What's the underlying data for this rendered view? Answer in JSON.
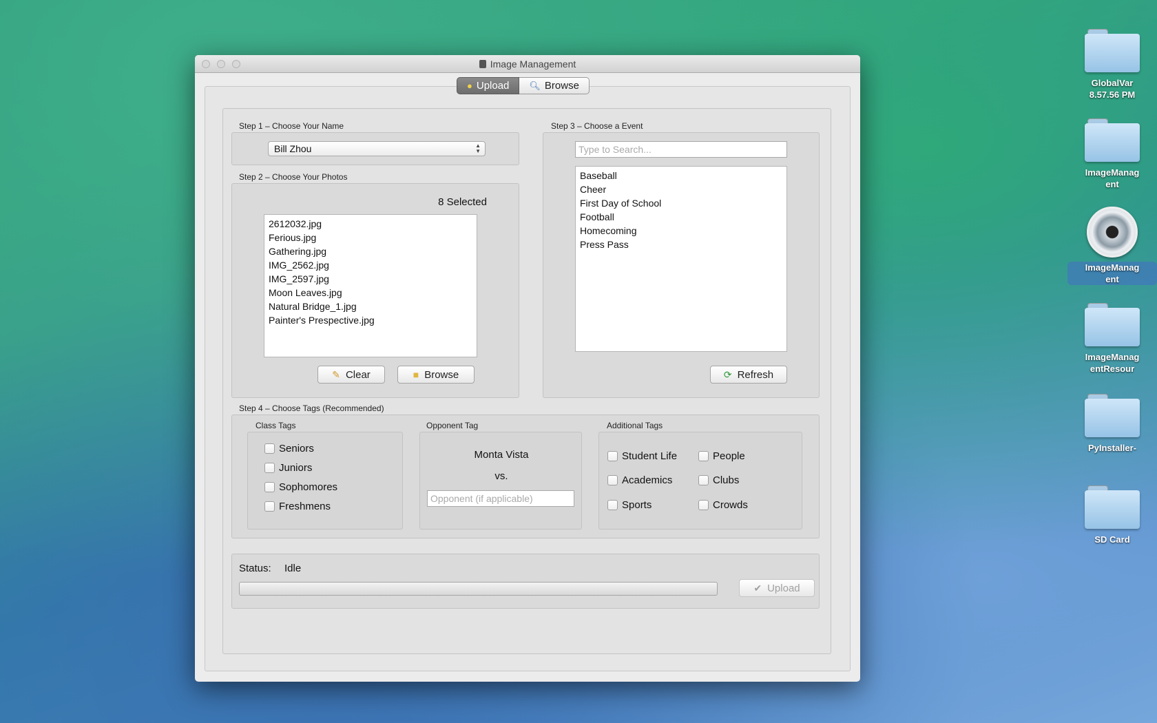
{
  "desktop": {
    "icons": [
      {
        "label": "GlobalVar\n8.57.56 PM",
        "kind": "folder"
      },
      {
        "label": "ImageManag\nent",
        "kind": "folder"
      },
      {
        "label": "ImageManag\nent",
        "kind": "app"
      },
      {
        "label": "ImageManag\nentResour",
        "kind": "folder"
      },
      {
        "label": "PyInstaller-",
        "kind": "folder"
      },
      {
        "label": "SD Card",
        "kind": "folder"
      }
    ]
  },
  "window": {
    "title": "Image Management",
    "tabs": [
      {
        "label": "Upload",
        "active": true
      },
      {
        "label": "Browse",
        "active": false
      }
    ]
  },
  "step1": {
    "label": "Step 1 – Choose Your Name",
    "selected_name": "Bill Zhou"
  },
  "step2": {
    "label": "Step 2 – Choose Your Photos",
    "selected_count": "8 Selected",
    "photos": [
      "2612032.jpg",
      "Ferious.jpg",
      "Gathering.jpg",
      "IMG_2562.jpg",
      "IMG_2597.jpg",
      "Moon Leaves.jpg",
      "Natural Bridge_1.jpg",
      "Painter's Prespective.jpg"
    ],
    "clear_label": "Clear",
    "browse_label": "Browse"
  },
  "step3": {
    "label": "Step 3 – Choose a Event",
    "search_placeholder": "Type to Search...",
    "events": [
      "Baseball",
      "Cheer",
      "First Day of School",
      "Football",
      "Homecoming",
      "Press Pass"
    ],
    "refresh_label": "Refresh"
  },
  "step4": {
    "label": "Step 4 – Choose Tags (Recommended)",
    "class_tags": {
      "label": "Class Tags",
      "items": [
        "Seniors",
        "Juniors",
        "Sophomores",
        "Freshmens"
      ]
    },
    "opponent_tag": {
      "label": "Opponent Tag",
      "home": "Monta Vista",
      "vs": "vs.",
      "placeholder": "Opponent (if applicable)"
    },
    "additional_tags": {
      "label": "Additional Tags",
      "items": [
        "Student Life",
        "People",
        "Academics",
        "Clubs",
        "Sports",
        "Crowds"
      ]
    }
  },
  "status": {
    "label": "Status:",
    "value": "Idle",
    "progress": 0,
    "upload_label": "Upload"
  }
}
